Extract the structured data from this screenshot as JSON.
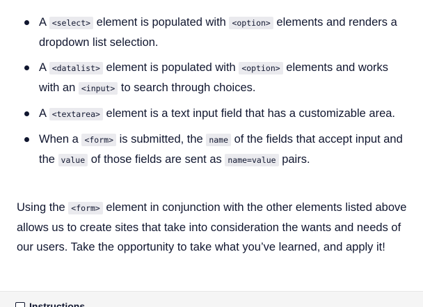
{
  "bullets": [
    {
      "t1": "A ",
      "c1": "<select>",
      "t2": " element is populated with ",
      "c2": "<option>",
      "t3": " elements and renders a dropdown list selection."
    },
    {
      "t1": "A ",
      "c1": "<datalist>",
      "t2": " element is populated with ",
      "c2": "<option>",
      "t3": " elements and works with an ",
      "c3": "<input>",
      "t4": " to search through choices."
    },
    {
      "t1": "A ",
      "c1": "<textarea>",
      "t2": " element is a text input field that has a customizable area."
    },
    {
      "t1": "When a ",
      "c1": "<form>",
      "t2": " is submitted, the ",
      "c2": "name",
      "t3": " of the fields that accept input and the ",
      "c3": "value",
      "t4": " of those fields are sent as ",
      "c4": "name=value",
      "t5": " pairs."
    }
  ],
  "paragraph": {
    "t1": "Using the ",
    "c1": "<form>",
    "t2": " element in conjunction with the other elements listed above allows us to create sites that take into consideration the wants and needs of our users. Take the opportunity to take what you’ve learned, and apply it!"
  },
  "footer": {
    "label": "Instructions"
  },
  "colors": {
    "text": "#10162f",
    "code_background": "#eaeaee",
    "footer_background": "#f5f5f5"
  }
}
